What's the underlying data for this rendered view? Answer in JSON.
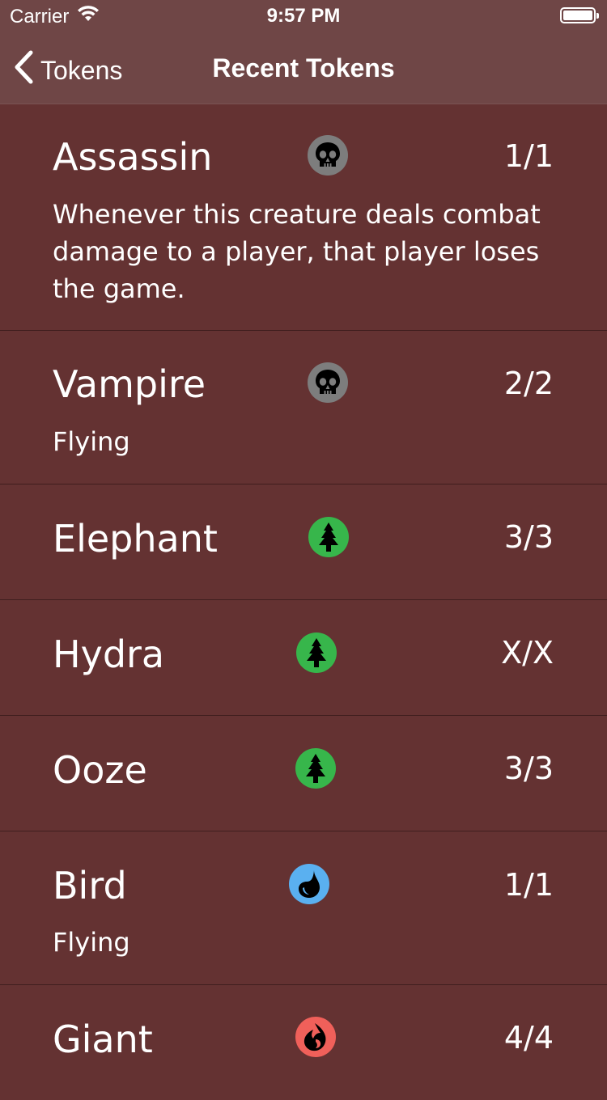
{
  "status_bar": {
    "carrier": "Carrier",
    "time": "9:57 PM"
  },
  "nav": {
    "back_label": "Tokens",
    "title": "Recent Tokens"
  },
  "tokens": [
    {
      "name": "Assassin",
      "mana": "skull-icon",
      "stats": "1/1",
      "ability": "Whenever this creature deals combat damage to a player, that player loses the game."
    },
    {
      "name": "Vampire",
      "mana": "skull-icon",
      "stats": "2/2",
      "ability": "Flying"
    },
    {
      "name": "Elephant",
      "mana": "tree-icon",
      "stats": "3/3",
      "ability": ""
    },
    {
      "name": "Hydra",
      "mana": "tree-icon",
      "stats": "X/X",
      "ability": ""
    },
    {
      "name": "Ooze",
      "mana": "tree-icon",
      "stats": "3/3",
      "ability": ""
    },
    {
      "name": "Bird",
      "mana": "water-drop-icon",
      "stats": "1/1",
      "ability": "Flying"
    },
    {
      "name": "Giant",
      "mana": "fire-icon",
      "stats": "4/4",
      "ability": ""
    }
  ],
  "colors": {
    "background": "#643232",
    "nav_background": "#6f4646",
    "separator": "#3f1e1e",
    "black_mana": "#7d7d7d",
    "green_mana": "#37b64b",
    "blue_mana": "#5ab0f0",
    "red_mana": "#f0605a"
  }
}
